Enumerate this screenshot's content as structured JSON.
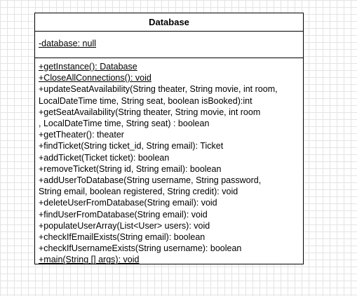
{
  "diagram": {
    "class_name": "Database",
    "attributes": [
      {
        "text": "-database: null",
        "static": true
      }
    ],
    "methods": [
      {
        "text": "+getInstance(): Database",
        "static": true
      },
      {
        "text": "+CloseAllConnections(): void",
        "static": true
      },
      {
        "text": "+updateSeatAvailability(String theater, String movie, int room,",
        "static": false
      },
      {
        "text": " LocalDateTime time, String seat, boolean isBooked):int",
        "static": false
      },
      {
        "text": "+getSeatAvailability(String theater, String movie, int room",
        "static": false
      },
      {
        "text": ", LocalDateTime time, String seat) : boolean",
        "static": false
      },
      {
        "text": "+getTheater(): theater",
        "static": false
      },
      {
        "text": "+findTicket(String ticket_id, String email): Ticket",
        "static": false
      },
      {
        "text": "+addTicket(Ticket ticket): boolean",
        "static": false
      },
      {
        "text": "+removeTicket(String id, String email): boolean",
        "static": false
      },
      {
        "text": "+addUserToDatabase(String username, String password,",
        "static": false
      },
      {
        "text": "String email, boolean registered, String credit): void",
        "static": false
      },
      {
        "text": "+deleteUserFromDatabase(String email): void",
        "static": false
      },
      {
        "text": "+findUserFromDatabase(String email): void",
        "static": false
      },
      {
        "text": "+populateUserArray(List<User> users): void",
        "static": false
      },
      {
        "text": "+checkIfEmailExists(String email): boolean",
        "static": false
      },
      {
        "text": "+checkIfUsernameExists(String username): boolean",
        "static": false
      },
      {
        "text": "+main(String [] args): void",
        "static": true
      }
    ]
  }
}
